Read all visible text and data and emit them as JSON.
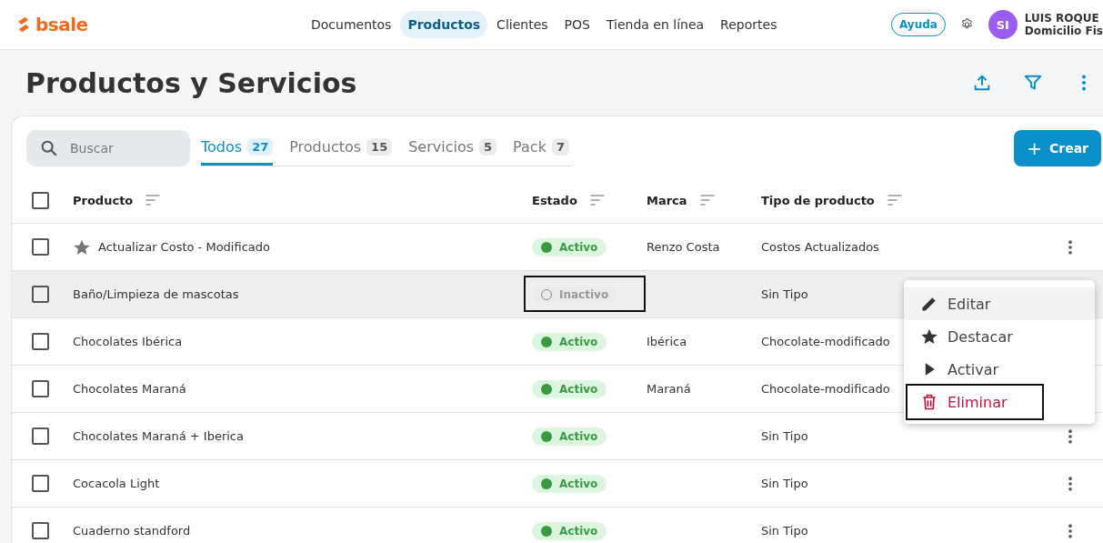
{
  "topbar": {
    "logo": "bsale",
    "nav": [
      {
        "label": "Documentos",
        "selected": false
      },
      {
        "label": "Productos",
        "selected": true
      },
      {
        "label": "Clientes",
        "selected": false
      },
      {
        "label": "POS",
        "selected": false
      },
      {
        "label": "Tienda en línea",
        "selected": false
      },
      {
        "label": "Reportes",
        "selected": false
      }
    ],
    "help": "Ayuda",
    "user": {
      "initials": "SI",
      "name": "LUIS ROQUE",
      "company": "Domicilio Fis"
    }
  },
  "page": {
    "title": "Productos y Servicios"
  },
  "search": {
    "placeholder": "Buscar"
  },
  "tabs": [
    {
      "label": "Todos",
      "count": "27",
      "selected": true
    },
    {
      "label": "Productos",
      "count": "15",
      "selected": false
    },
    {
      "label": "Servicios",
      "count": "5",
      "selected": false
    },
    {
      "label": "Pack",
      "count": "7",
      "selected": false
    }
  ],
  "create_button": {
    "icon": "+",
    "label": "Crear"
  },
  "table": {
    "select_all_checked": false,
    "columns": [
      "Producto",
      "Estado",
      "Marca",
      "Tipo de producto"
    ],
    "rows": [
      {
        "product": "Actualizar Costo - Modificado",
        "featured": true,
        "status": {
          "label": "Activo",
          "active": true,
          "highlighted": false
        },
        "brand": "Renzo Costa",
        "type": "Costos Actualizados",
        "hovered": false,
        "checked": false,
        "menu": true
      },
      {
        "product": "Baño/Limpieza de mascotas",
        "featured": false,
        "status": {
          "label": "Inactivo",
          "active": false,
          "highlighted": true
        },
        "type": "Sin Tipo",
        "hovered": true,
        "checked": false,
        "menu": false
      },
      {
        "product": "Chocolates Ibérica",
        "featured": false,
        "status": {
          "label": "Activo",
          "active": true,
          "highlighted": false
        },
        "brand": "Ibérica",
        "type": "Chocolate-modificado",
        "hovered": false,
        "checked": false,
        "menu": false
      },
      {
        "product": "Chocolates Maraná",
        "featured": false,
        "status": {
          "label": "Activo",
          "active": true,
          "highlighted": false
        },
        "brand": "Maraná",
        "type": "Chocolate-modificado",
        "hovered": false,
        "checked": false,
        "menu": false
      },
      {
        "product": "Chocolates Maraná + Iberica",
        "featured": false,
        "status": {
          "label": "Activo",
          "active": true,
          "highlighted": false
        },
        "type": "Sin Tipo",
        "hovered": false,
        "checked": false,
        "menu": true
      },
      {
        "product": "Cocacola Light",
        "featured": false,
        "status": {
          "label": "Activo",
          "active": true,
          "highlighted": false
        },
        "type": "Sin Tipo",
        "hovered": false,
        "checked": false,
        "menu": true
      },
      {
        "product": "Cuaderno standford",
        "featured": false,
        "status": {
          "label": "Activo",
          "active": true,
          "highlighted": false
        },
        "type": "Sin Tipo",
        "hovered": false,
        "checked": false,
        "menu": true
      }
    ]
  },
  "context_menu": {
    "items": [
      {
        "kind": "edit",
        "label": "Editar",
        "hovered": true,
        "highlighted": false
      },
      {
        "kind": "star",
        "label": "Destacar",
        "hovered": false,
        "highlighted": false
      },
      {
        "kind": "play",
        "label": "Activar",
        "hovered": false,
        "highlighted": false
      },
      {
        "kind": "delete",
        "label": "Eliminar",
        "hovered": false,
        "highlighted": true
      }
    ]
  }
}
